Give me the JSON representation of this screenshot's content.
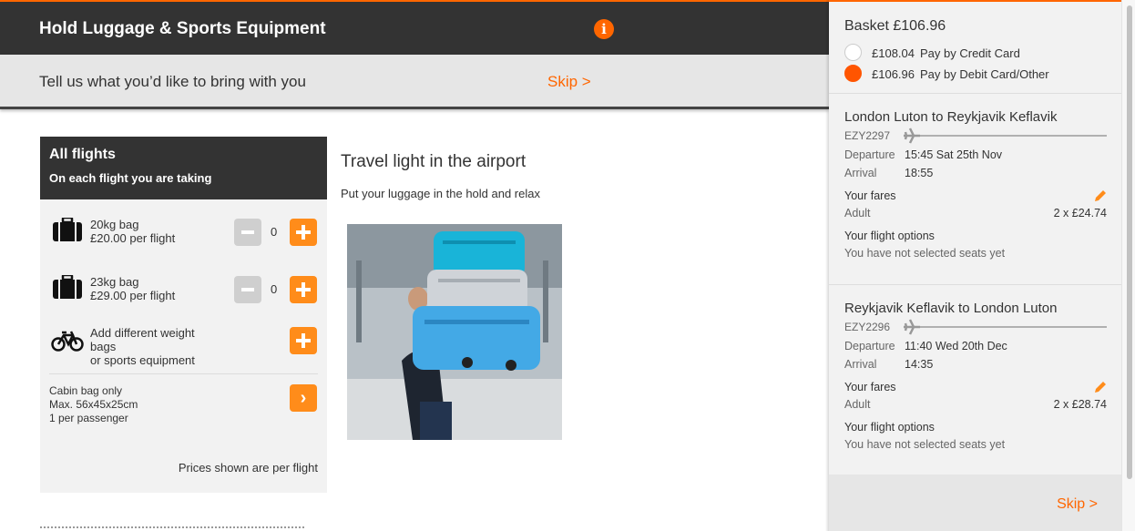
{
  "header": {
    "title": "Hold Luggage & Sports Equipment",
    "info_icon": "info-icon",
    "info_glyph": "i"
  },
  "subbar": {
    "text": "Tell us what you’d like to bring with you",
    "skip": "Skip >"
  },
  "panel": {
    "title": "All flights",
    "subtitle": "On each flight you are taking",
    "bags": [
      {
        "name": "20kg bag",
        "price": "£20.00 per flight",
        "qty": "0",
        "icon": "suitcase-icon"
      },
      {
        "name": "23kg bag",
        "price": "£29.00 per flight",
        "qty": "0",
        "icon": "suitcase-icon"
      }
    ],
    "sports": {
      "line1": "Add different weight",
      "line2": "bags",
      "line3": "or sports equipment",
      "icon": "bicycle-icon"
    },
    "cabin": {
      "line1": "Cabin bag only",
      "line2": "Max. 56x45x25cm",
      "line3": "1 per passenger"
    },
    "prices_note": "Prices shown are per flight"
  },
  "content": {
    "title": "Travel light in the airport",
    "subtitle": "Put your luggage in the hold and relax"
  },
  "basket": {
    "title": "Basket £106.96",
    "payment_options": [
      {
        "amount": "£108.04",
        "label": "Pay by Credit Card",
        "selected": false
      },
      {
        "amount": "£106.96",
        "label": "Pay by Debit Card/Other",
        "selected": true
      }
    ],
    "flights": [
      {
        "route": "London Luton to Reykjavik Keflavik",
        "code": "EZY2297",
        "departure_label": "Departure",
        "departure": "15:45 Sat 25th Nov",
        "arrival_label": "Arrival",
        "arrival": "18:55",
        "fares_label": "Your fares",
        "passenger": "Adult",
        "fare": "2 x £24.74",
        "options_label": "Your flight options",
        "options_text": "You have not selected seats yet"
      },
      {
        "route": "Reykjavik Keflavik to London Luton",
        "code": "EZY2296",
        "departure_label": "Departure",
        "departure": "11:40 Wed 20th Dec",
        "arrival_label": "Arrival",
        "arrival": "14:35",
        "fares_label": "Your fares",
        "passenger": "Adult",
        "fare": "2 x £28.74",
        "options_label": "Your flight options",
        "options_text": "You have not selected seats yet"
      }
    ],
    "skip": "Skip >"
  },
  "colors": {
    "accent": "#ff6600",
    "button": "#ff8c1a",
    "dark": "#333333",
    "panel": "#f2f2f2"
  }
}
